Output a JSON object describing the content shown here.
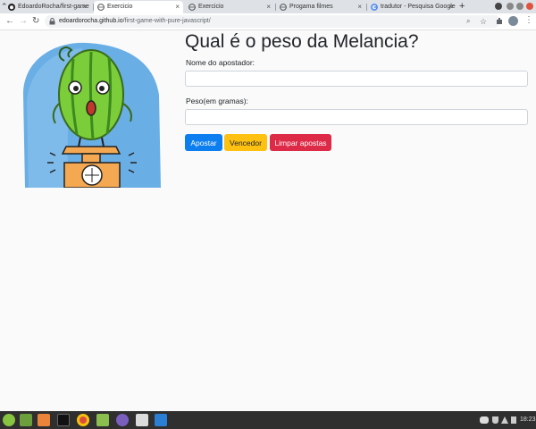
{
  "browser": {
    "tabs": [
      {
        "label": "EdoardoRocha/first-game",
        "icon": "github-icon"
      },
      {
        "label": "Exercicio",
        "icon": "globe-icon",
        "active": true
      },
      {
        "label": "Exercicio",
        "icon": "globe-icon"
      },
      {
        "label": "Progama filmes",
        "icon": "globe-icon"
      },
      {
        "label": "tradutor - Pesquisa Google",
        "icon": "google-icon"
      }
    ],
    "tab_close": "×",
    "new_tab": "+",
    "url_host": "edoardorocha.github.io",
    "url_path": "/first-game-with-pure-javascript/"
  },
  "page": {
    "title": "Qual é o peso da Melancia?",
    "name_label": "Nome do apostador:",
    "name_value": "",
    "weight_label": "Peso(em gramas):",
    "weight_value": "",
    "buttons": {
      "bet": "Apostar",
      "winner": "Vencedor",
      "clear": "Limpar apostas"
    }
  },
  "colors": {
    "bet": "#0d7ef0",
    "winner": "#fec011",
    "clear": "#dd2a47",
    "scene_bg": "#6aaee6",
    "watermelon": "#7ccd3a",
    "scale": "#f5a852"
  },
  "taskbar": {
    "clock": "18:23",
    "apps": [
      "mint-menu-icon",
      "files-icon",
      "software-icon",
      "terminal-icon",
      "chrome-icon",
      "folder-icon",
      "github-desktop-icon",
      "typora-icon",
      "vscode-icon"
    ]
  }
}
